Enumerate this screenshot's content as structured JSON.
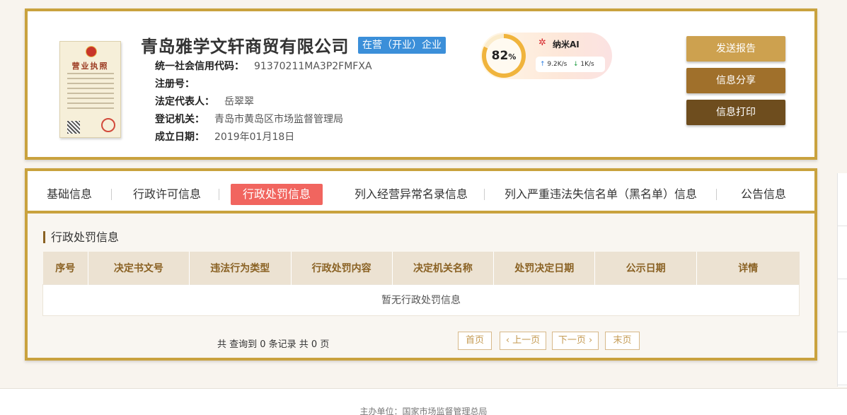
{
  "company": {
    "name": "青岛雅学文轩商贸有限公司",
    "status": "在营（开业）企业",
    "license_title": "营业执照"
  },
  "info": [
    {
      "key": "统一社会信用代码：",
      "value": "91370211MA3P2FMFXA"
    },
    {
      "key": "注册号：",
      "value": ""
    },
    {
      "key": "法定代表人：",
      "value": "岳翠翠"
    },
    {
      "key": "登记机关：",
      "value": "青岛市黄岛区市场监督管理局"
    },
    {
      "key": "成立日期：",
      "value": "2019年01月18日"
    }
  ],
  "score": {
    "value": "82",
    "unit": "%",
    "fill_fraction": 0.82,
    "ai_label": "纳米AI",
    "upload": "9.2K/s",
    "download": "1K/s",
    "ring_color": "#f0b43c"
  },
  "actions": {
    "send": "发送报告",
    "share": "信息分享",
    "print": "信息打印"
  },
  "tabs": [
    {
      "label": "基础信息",
      "active": false
    },
    {
      "label": "行政许可信息",
      "active": false
    },
    {
      "label": "行政处罚信息",
      "active": true
    },
    {
      "label": "列入经营异常名录信息",
      "active": false
    },
    {
      "label": "列入严重违法失信名单（黑名单）信息",
      "active": false
    },
    {
      "label": "公告信息",
      "active": false
    }
  ],
  "section": {
    "title": "行政处罚信息",
    "columns": [
      "序号",
      "决定书文号",
      "违法行为类型",
      "行政处罚内容",
      "决定机关名称",
      "处罚决定日期",
      "公示日期",
      "详情"
    ],
    "empty_text": "暂无行政处罚信息"
  },
  "pager": {
    "summary": "共 查询到 0 条记录 共 0 页",
    "first": "首页",
    "prev": "上一页",
    "next": "下一页",
    "last": "末页"
  },
  "footer": {
    "text": "主办单位：国家市场监督管理总局"
  },
  "colors": {
    "gold": "#c9a23e",
    "active_tab": "#f1655f",
    "badge": "#3b8fd9"
  }
}
